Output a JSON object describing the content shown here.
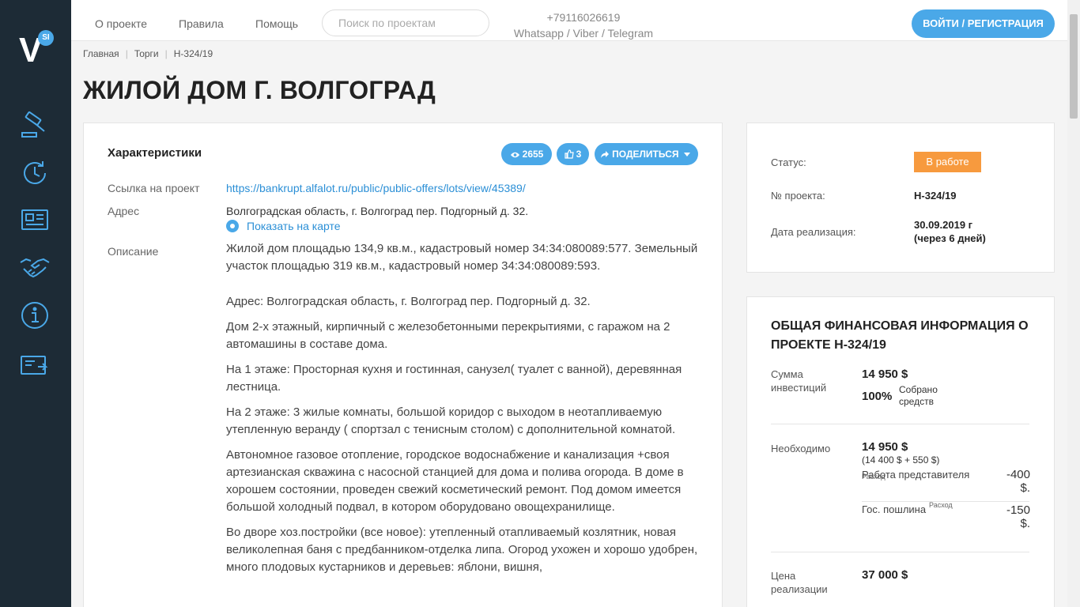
{
  "logo": {
    "letter": "V",
    "badge": "SI"
  },
  "sidebar": {
    "icons": [
      "gavel-icon",
      "refresh-clock-icon",
      "newspaper-icon",
      "handshake-icon",
      "info-icon",
      "mail-card-icon"
    ]
  },
  "header": {
    "nav": [
      "О проекте",
      "Правила",
      "Помощь"
    ],
    "search_placeholder": "Поиск по проектам",
    "phone": "+79116026619",
    "messengers": "Whatsapp / Viber / Telegram",
    "login_label": "ВОЙТИ / РЕГИСТРАЦИЯ"
  },
  "breadcrumb": [
    "Главная",
    "Торги",
    "Н-324/19"
  ],
  "page_title": "ЖИЛОЙ ДОМ Г. ВОЛГОГРАД",
  "characteristics": {
    "title": "Характеристики",
    "views": "2655",
    "likes": "3",
    "share_label": "ПОДЕЛИТЬСЯ",
    "link_label": "Ссылка на проект",
    "link_value": "https://bankrupt.alfalot.ru/public/public-offers/lots/view/45389/",
    "address_label": "Адрес",
    "address_value": "Волгоградская область, г. Волгоград пер. Подгорный д. 32.",
    "map_label": "Показать на карте",
    "description_label": "Описание",
    "description": [
      "Жилой дом площадью 134,9 кв.м., кадастровый номер 34:34:080089:577. Земельный участок площадью 319 кв.м., кадастровый номер 34:34:080089:593.",
      "Адрес: Волгоградская область, г. Волгоград пер. Подгорный д. 32.",
      "Дом 2-х этажный, кирпичный с железобетонными перекрытиями, с гаражом на 2 автомашины в составе дома.",
      "На 1 этаже: Просторная кухня и гостинная, санузел( туалет с ванной), деревянная лестница.",
      "На 2 этаже: 3 жилые комнаты, большой коридор с выходом в неотапливаемую утепленную веранду ( спортзал с тенисным столом) с дополнительной комнатой.",
      "Автономное газовое отопление, городское водоснабжение и канализация +своя артезианская скважина с насосной станцией для дома и полива огорода. В доме в хорошем состоянии, проведен свежий косметический ремонт. Под домом имеется большой холодный подвал, в котором оборудовано овощехранилище.",
      "Во дворе хоз.постройки (все новое): утепленный отапливаемый козлятник, новая великолепная баня с предбанником-отделка липа. Огород ухожен и хорошо удобрен, много плодовых кустарников и деревьев: яблони, вишня,"
    ]
  },
  "status": {
    "status_label": "Статус:",
    "status_value": "В работе",
    "status_color": "#f79a3e",
    "number_label": "№ проекта:",
    "number_value": "Н-324/19",
    "date_label": "Дата реализация:",
    "date_value": "30.09.2019 г",
    "date_note": "(через 6 дней)"
  },
  "finance": {
    "title": "ОБЩАЯ ФИНАНСОВАЯ ИНФОРМАЦИЯ О ПРОЕКТЕ Н-324/19",
    "invest_label": "Сумма инвестиций",
    "invest_value": "14 950 $",
    "collected_pct": "100%",
    "collected_label": "Собрано средств",
    "collected_fraction": 1.0,
    "needed_label": "Необходимо",
    "needed_value": "14 950 $",
    "needed_breakdown": "(14 400 $ + 550 $)",
    "expenses": [
      {
        "name": "Работа представителя",
        "tag": "Расход",
        "amount": "-400 $."
      },
      {
        "name": "Гос. пошлина",
        "tag": "Расход",
        "amount": "-150 $."
      }
    ],
    "price_label": "Цена реализации",
    "price_value": "37 000 $"
  },
  "accent_color": "#4aa8e8"
}
